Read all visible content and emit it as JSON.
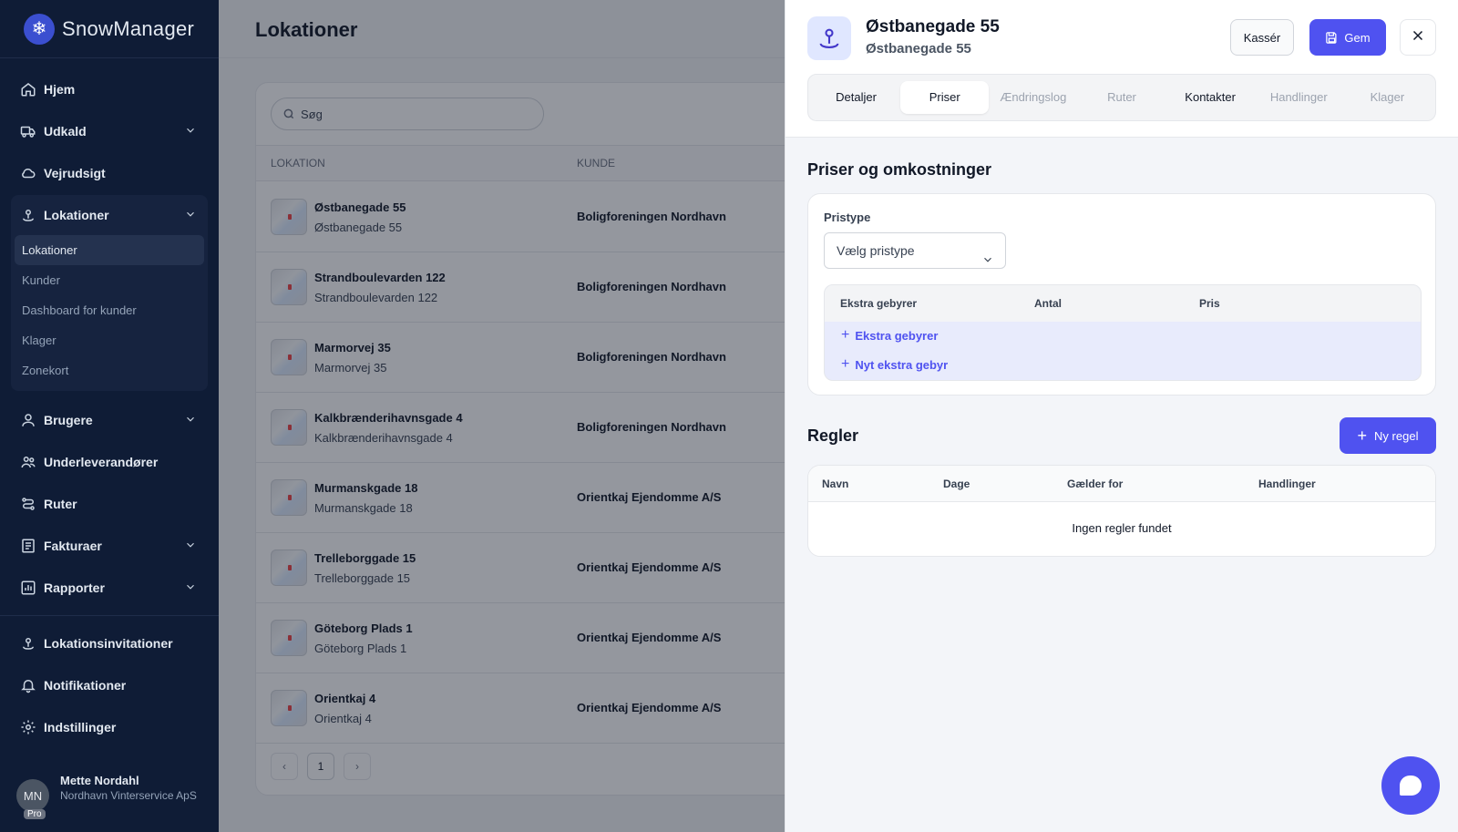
{
  "app": {
    "name": "SnowManager"
  },
  "sidebar": {
    "items": [
      {
        "label": "Hjem",
        "icon": "home-icon"
      },
      {
        "label": "Udkald",
        "icon": "truck-icon",
        "expandable": true
      },
      {
        "label": "Vejrudsigt",
        "icon": "cloud-icon"
      },
      {
        "label": "Lokationer",
        "icon": "location-pin-icon",
        "expandable": true,
        "expanded": true,
        "children": [
          "Lokationer",
          "Kunder",
          "Dashboard for kunder",
          "Klager",
          "Zonekort"
        ]
      },
      {
        "label": "Brugere",
        "icon": "user-icon",
        "expandable": true
      },
      {
        "label": "Underleverandører",
        "icon": "users-icon"
      },
      {
        "label": "Ruter",
        "icon": "route-icon"
      },
      {
        "label": "Fakturaer",
        "icon": "invoice-icon",
        "expandable": true
      },
      {
        "label": "Rapporter",
        "icon": "chart-icon",
        "expandable": true
      }
    ],
    "secondary": [
      {
        "label": "Lokationsinvitationer",
        "icon": "location-pin-icon"
      },
      {
        "label": "Notifikationer",
        "icon": "bell-icon"
      },
      {
        "label": "Indstillinger",
        "icon": "gear-icon"
      }
    ],
    "user": {
      "initials": "MN",
      "badge": "Pro",
      "name": "Mette Nordahl",
      "org": "Nordhavn Vinterservice ApS"
    }
  },
  "main": {
    "title": "Lokationer",
    "search_placeholder": "Søg",
    "columns": [
      "LOKATION",
      "KUNDE"
    ],
    "rows": [
      {
        "name": "Østbanegade 55",
        "address": "Østbanegade 55",
        "customer": "Boligforeningen Nordhavn"
      },
      {
        "name": "Strandboulevarden 122",
        "address": "Strandboulevarden 122",
        "customer": "Boligforeningen Nordhavn"
      },
      {
        "name": "Marmorvej 35",
        "address": "Marmorvej 35",
        "customer": "Boligforeningen Nordhavn"
      },
      {
        "name": "Kalkbrænderihavnsgade 4",
        "address": "Kalkbrænderihavnsgade 4",
        "customer": "Boligforeningen Nordhavn"
      },
      {
        "name": "Murmanskgade 18",
        "address": "Murmanskgade 18",
        "customer": "Orientkaj Ejendomme A/S"
      },
      {
        "name": "Trelleborggade 15",
        "address": "Trelleborggade 15",
        "customer": "Orientkaj Ejendomme A/S"
      },
      {
        "name": "Göteborg Plads 1",
        "address": "Göteborg Plads 1",
        "customer": "Orientkaj Ejendomme A/S"
      },
      {
        "name": "Orientkaj 4",
        "address": "Orientkaj 4",
        "customer": "Orientkaj Ejendomme A/S"
      }
    ],
    "pagination": {
      "prev": "‹",
      "page": "1",
      "next": "›"
    }
  },
  "drawer": {
    "title": "Østbanegade 55",
    "subtitle": "Østbanegade 55",
    "cancel_label": "Kassér",
    "save_label": "Gem",
    "tabs": [
      {
        "label": "Detaljer",
        "state": "dark"
      },
      {
        "label": "Priser",
        "state": "active"
      },
      {
        "label": "Ændringslog",
        "state": "muted"
      },
      {
        "label": "Ruter",
        "state": "muted"
      },
      {
        "label": "Kontakter",
        "state": "dark"
      },
      {
        "label": "Handlinger",
        "state": "muted"
      },
      {
        "label": "Klager",
        "state": "muted"
      }
    ],
    "pricing": {
      "title": "Priser og omkostninger",
      "pristype_label": "Pristype",
      "pristype_value": "Vælg pristype",
      "fees_columns": [
        "Ekstra gebyrer",
        "Antal",
        "Pris"
      ],
      "fee_links": [
        "Ekstra gebyrer",
        "Nyt ekstra gebyr"
      ]
    },
    "rules": {
      "title": "Regler",
      "new_label": "Ny regel",
      "columns": [
        "Navn",
        "Dage",
        "Gælder for",
        "Handlinger"
      ],
      "empty": "Ingen regler fundet"
    }
  },
  "colors": {
    "sidebar_bg": "#0f1c36",
    "accent": "#4f52f0",
    "fees_bg": "#e8ebfc"
  }
}
